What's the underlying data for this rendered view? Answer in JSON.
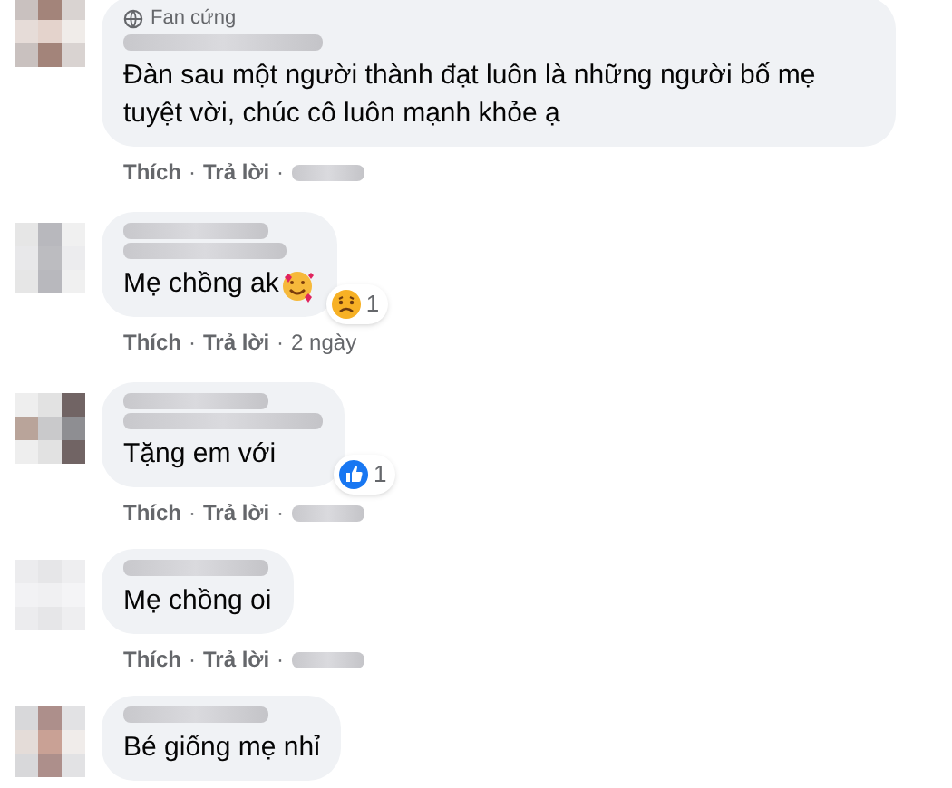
{
  "comments": [
    {
      "badge": "Fan cứng",
      "text": "Đàn sau một người thành đạt luôn là những người bố mẹ tuyệt vời, chúc cô luôn mạnh khỏe ạ",
      "actions": [
        "Thích",
        "Trả lời"
      ],
      "separator": "·"
    },
    {
      "text": "Mẹ chồng ak",
      "emoji": true,
      "reaction": {
        "kind": "sad",
        "count": "1"
      },
      "actions": [
        "Thích",
        "Trả lời"
      ],
      "separator": "·",
      "time": "2 ngày"
    },
    {
      "text": "Tặng em với",
      "reaction": {
        "kind": "like",
        "count": "1"
      },
      "actions": [
        "Thích",
        "Trả lời"
      ],
      "separator": "·"
    },
    {
      "text": "Mẹ chồng oi",
      "actions": [
        "Thích",
        "Trả lời"
      ],
      "separator": "·"
    },
    {
      "text": "Bé giống mẹ nhỉ"
    }
  ]
}
